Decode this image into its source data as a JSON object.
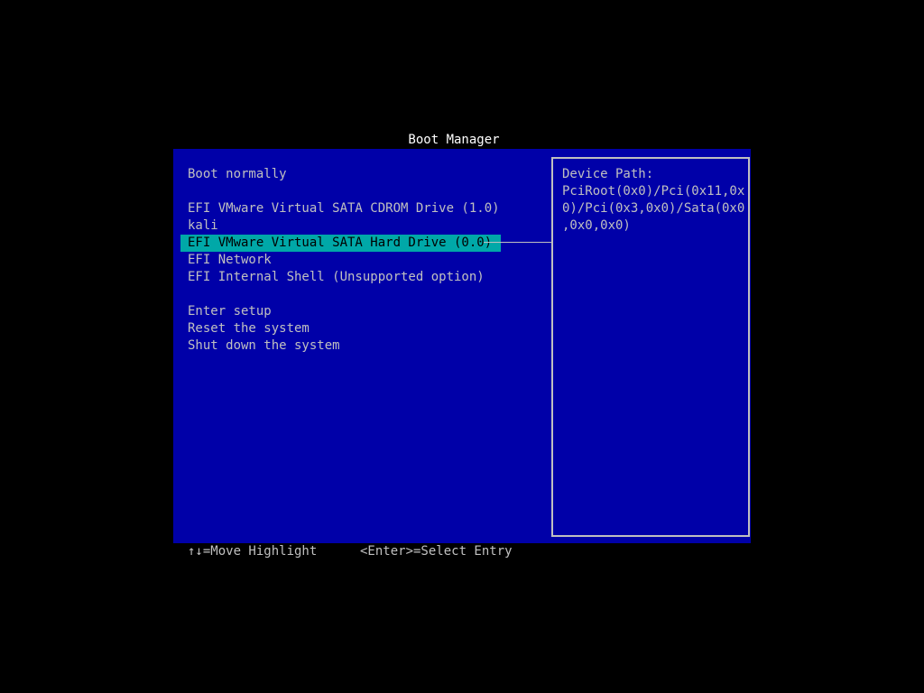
{
  "title": "Boot Manager",
  "menu": {
    "groups": [
      [
        "Boot normally"
      ],
      [
        "EFI VMware Virtual SATA CDROM Drive (1.0)",
        "kali",
        "EFI VMware Virtual SATA Hard Drive (0.0)",
        "EFI Network",
        "EFI Internal Shell (Unsupported option)"
      ],
      [
        "Enter setup",
        "Reset the system",
        "Shut down the system"
      ]
    ],
    "selected": "EFI VMware Virtual SATA Hard Drive (0.0)"
  },
  "info": {
    "lines": [
      "Device Path:",
      "PciRoot(0x0)/Pci(0x11,0x",
      "0)/Pci(0x3,0x0)/Sata(0x0",
      ",0x0,0x0)"
    ]
  },
  "help": {
    "move": "↑↓=Move Highlight",
    "select": "<Enter>=Select Entry"
  },
  "colors": {
    "background": "#000000",
    "panel": "#0000a8",
    "highlight": "#00a8a8",
    "text": "#c0c0c0",
    "title": "#ffffff"
  }
}
